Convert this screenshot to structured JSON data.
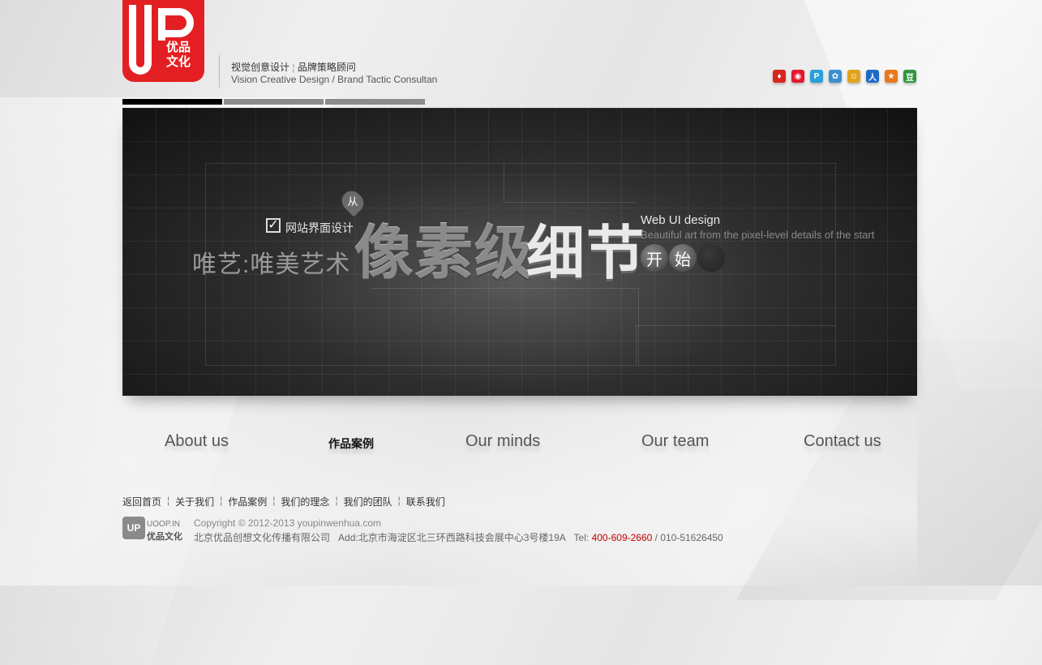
{
  "header": {
    "logo_letters": "UP",
    "logo_text": "优品文化",
    "tagline_cn_1": "视觉创意设计",
    "tagline_sep": "¦",
    "tagline_cn_2": "品牌策略顾问",
    "tagline_en": "Vision Creative Design / Brand Tactic Consultan"
  },
  "social_icons": [
    {
      "name": "sina-qq-icon",
      "glyph": "♦",
      "color": "#d7261e"
    },
    {
      "name": "weibo-icon",
      "glyph": "◉",
      "color": "#e6162d"
    },
    {
      "name": "paipai-icon",
      "glyph": "P",
      "color": "#2a9fd8"
    },
    {
      "name": "qq-icon",
      "glyph": "✿",
      "color": "#3a8fd1"
    },
    {
      "name": "kaixin-icon",
      "glyph": "☺",
      "color": "#e2a41c"
    },
    {
      "name": "renren-icon",
      "glyph": "人",
      "color": "#1f6cc5"
    },
    {
      "name": "qzone-icon",
      "glyph": "★",
      "color": "#e8781c"
    },
    {
      "name": "douban-icon",
      "glyph": "豆",
      "color": "#2e963d"
    }
  ],
  "slider": {
    "tabs": 3,
    "active_tab": 1
  },
  "banner": {
    "check_label": "网站界面设计",
    "pin_char": "从",
    "sub_title": "唯艺:唯美艺术",
    "big_1": "像素级",
    "big_2": "细节",
    "en_title": "Web UI design",
    "en_sub": "Beautiful art from the pixel-level details of the start",
    "circles": [
      "开",
      "始",
      ""
    ]
  },
  "nav": {
    "items": [
      {
        "label": "About us",
        "active": false
      },
      {
        "label": "作品案例",
        "active": true
      },
      {
        "label": "Our minds",
        "active": false
      },
      {
        "label": "Our team",
        "active": false
      },
      {
        "label": "Contact us",
        "active": false
      }
    ]
  },
  "footer": {
    "links": [
      "返回首页",
      "关于我们",
      "作品案例",
      "我们的理念",
      "我们的团队",
      "联系我们"
    ],
    "link_sep": "¦",
    "logo_mark": "UP",
    "logo_text_1": "UOOP.IN",
    "logo_text_2": "优品文化",
    "copyright": "Copyright © 2012-2013 youpinwenhua.com",
    "company": "北京优品创想文化传播有限公司",
    "address": "Add:北京市海淀区北三环西路科技会展中心3号楼19A",
    "tel_label": "Tel:",
    "tel_highlight": "400-609-2660",
    "tel_other": " / 010-51626450"
  }
}
